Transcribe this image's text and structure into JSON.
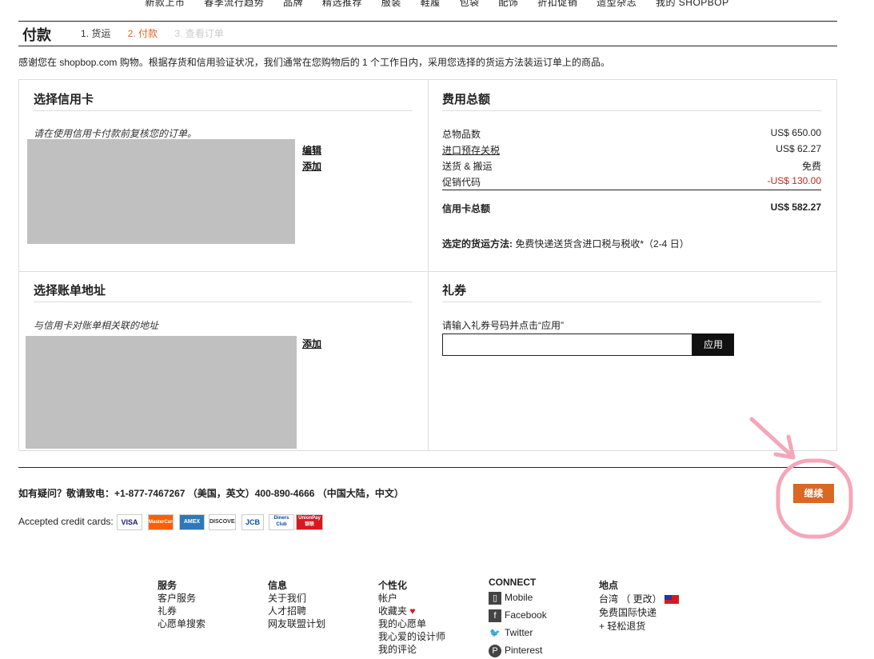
{
  "topnav": [
    "新款上市",
    "春季流行趋势",
    "品牌",
    "精选推荐",
    "服装",
    "鞋履",
    "包袋",
    "配饰",
    "折扣促销",
    "造型杂志",
    "我的 SHOPBOP"
  ],
  "page": {
    "title": "付款",
    "steps": [
      "1. 货运",
      "2. 付款",
      "3. 查看订单"
    ],
    "intro": "感谢您在 shopbop.com 购物。根据存货和信用验证状况，我们通常在您购物后的 1 个工作日内，采用您选择的货运方法装运订单上的商品。"
  },
  "credit_card": {
    "heading": "选择信用卡",
    "note": "请在使用信用卡付款前复核您的订单。",
    "edit": "编辑",
    "add": "添加"
  },
  "billing": {
    "heading": "选择账单地址",
    "note": "与信用卡对账单相关联的地址",
    "add": "添加"
  },
  "summary": {
    "heading": "费用总额",
    "rows": [
      {
        "label": "总物品数",
        "value": "US$ 650.00"
      },
      {
        "label": "进口预存关税",
        "value": "US$ 62.27"
      },
      {
        "label": "送货 & 搬运",
        "value": "免费"
      },
      {
        "label": "促销代码",
        "value": "-US$ 130.00"
      }
    ],
    "total_label": "信用卡总额",
    "total_value": "US$ 582.27",
    "method_label": "选定的货运方法:",
    "method_value": "免费快递送货含进口税与税收*（2-4 日）"
  },
  "gift": {
    "heading": "礼券",
    "prompt": "请输入礼券号码并点击“应用”",
    "input_value": "",
    "apply": "应用"
  },
  "help": "如有疑问？敬请致电：+1-877-7467267 （美国，英文）400-890-4666 （中国大陆，中文）",
  "continue_label": "继续",
  "accepted_label": "Accepted credit cards:",
  "cards": [
    "VISA",
    "MasterCard",
    "AMEX",
    "DISCOVER",
    "JCB",
    "Diners Club",
    "UnionPay 银联"
  ],
  "footer": {
    "service": {
      "title": "服务",
      "items": [
        "客户服务",
        "礼券",
        "心愿单搜索"
      ]
    },
    "info": {
      "title": "信息",
      "items": [
        "关于我们",
        "人才招聘",
        "网友联盟计划"
      ]
    },
    "personal": {
      "title": "个性化",
      "items": [
        "帐户",
        "收藏夹",
        "我的心愿单",
        "我心爱的设计师",
        "我的评论"
      ]
    },
    "connect": {
      "title": "CONNECT",
      "items": [
        "Mobile",
        "Facebook",
        "Twitter",
        "Pinterest"
      ]
    },
    "location": {
      "title": "地点",
      "region": "台湾 （ 更改）",
      "items": [
        "免费国际快递",
        "+ 轻松退货"
      ]
    }
  },
  "colors": {
    "accent": "#d96822",
    "promo": "#cc2222",
    "annotation": "#f4a7b9"
  }
}
